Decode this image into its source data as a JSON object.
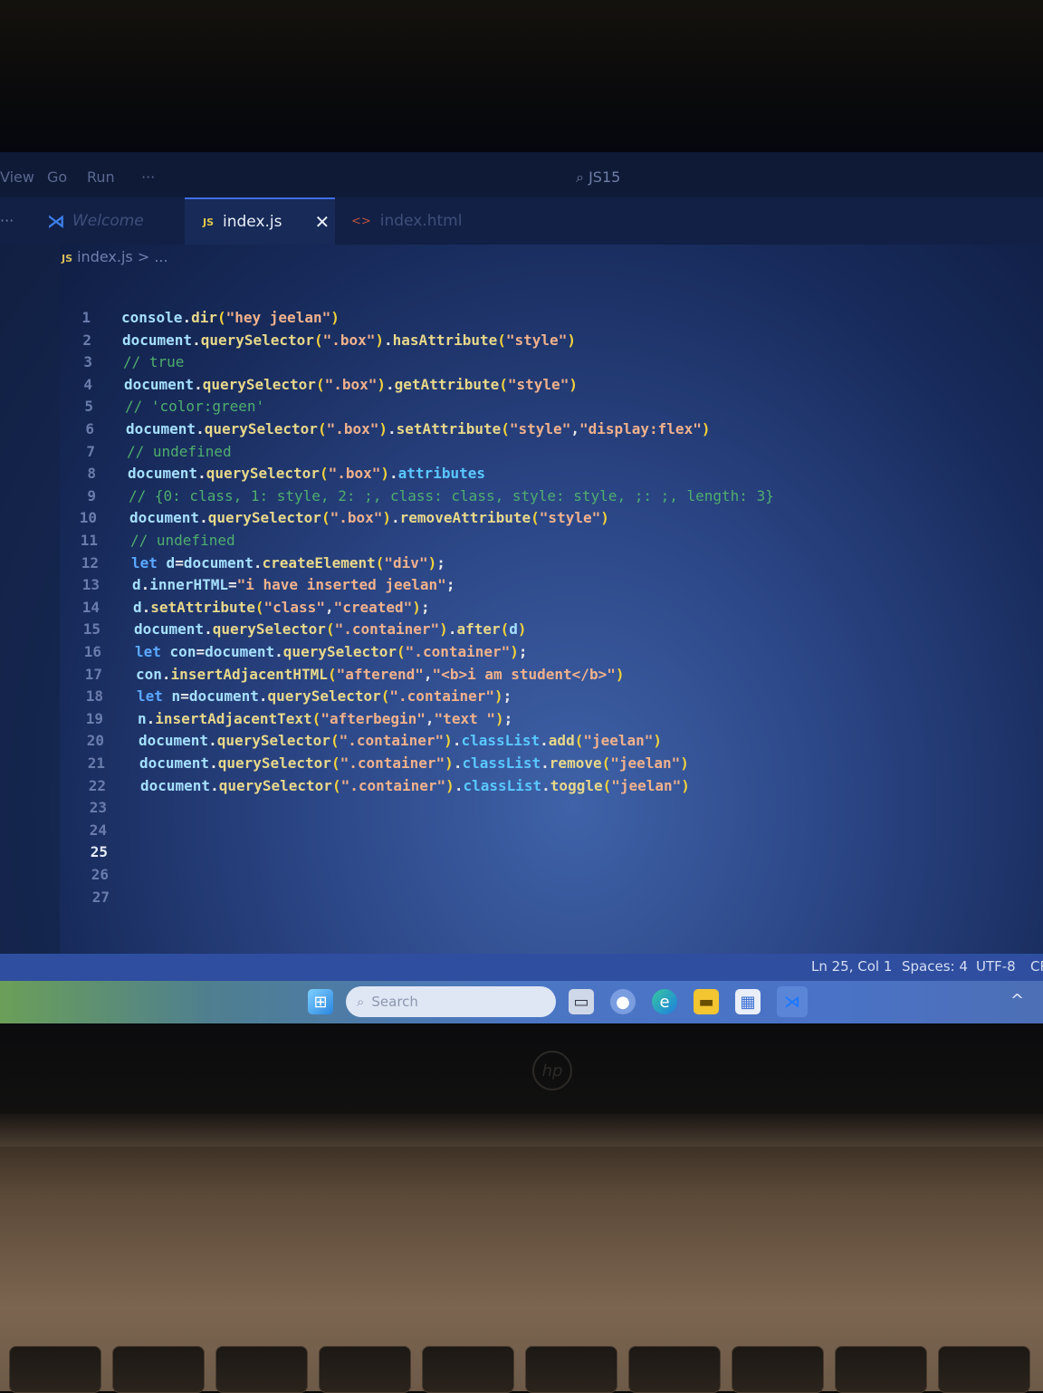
{
  "menubar": {
    "items": [
      "View",
      "Go",
      "Run",
      "···"
    ],
    "search": "JS15"
  },
  "tabs": [
    {
      "label": "Welcome",
      "icon": "vscode-logo-icon",
      "active": false
    },
    {
      "label": "index.js",
      "icon": "js-file-icon",
      "prefix": "JS",
      "active": true
    },
    {
      "label": "index.html",
      "icon": "html-file-icon",
      "active": false
    }
  ],
  "breadcrumb": {
    "prefix": "JS",
    "file": "index.js",
    "rest": "> ..."
  },
  "editor": {
    "lines": [
      {
        "n": "1",
        "text": "console.dir(\"hey jeelan\")"
      },
      {
        "n": "2",
        "text": "document.querySelector(\".box\").hasAttribute(\"style\")"
      },
      {
        "n": "3",
        "text": "// true"
      },
      {
        "n": "4",
        "text": "document.querySelector(\".box\").getAttribute(\"style\")"
      },
      {
        "n": "5",
        "text": "// 'color:green'"
      },
      {
        "n": "6",
        "text": "document.querySelector(\".box\").setAttribute(\"style\",\"display:flex\")"
      },
      {
        "n": "7",
        "text": "// undefined"
      },
      {
        "n": "8",
        "text": "document.querySelector(\".box\").attributes"
      },
      {
        "n": "9",
        "text": "// {0: class, 1: style, 2: ;, class: class, style: style, ;: ;, length: 3}"
      },
      {
        "n": "10",
        "text": "document.querySelector(\".box\").removeAttribute(\"style\")"
      },
      {
        "n": "11",
        "text": "// undefined"
      },
      {
        "n": "12",
        "text": "let d=document.createElement(\"div\");"
      },
      {
        "n": "13",
        "text": "d.innerHTML=\"i have inserted jeelan\";"
      },
      {
        "n": "14",
        "text": "d.setAttribute(\"class\",\"created\");"
      },
      {
        "n": "15",
        "text": "document.querySelector(\".container\").after(d)"
      },
      {
        "n": "16",
        "text": "let con=document.querySelector(\".container\");"
      },
      {
        "n": "17",
        "text": "con.insertAdjacentHTML(\"afterend\",\"<b>i am student</b>\")"
      },
      {
        "n": "18",
        "text": "let n=document.querySelector(\".container\");"
      },
      {
        "n": "19",
        "text": "n.insertAdjacentText(\"afterbegin\",\"text \");"
      },
      {
        "n": "20",
        "text": "document.querySelector(\".container\").classList.add(\"jeelan\")"
      },
      {
        "n": "21",
        "text": "document.querySelector(\".container\").classList.remove(\"jeelan\")"
      },
      {
        "n": "22",
        "text": "document.querySelector(\".container\").classList.toggle(\"jeelan\")"
      },
      {
        "n": "23",
        "text": ""
      },
      {
        "n": "24",
        "text": ""
      },
      {
        "n": "25",
        "text": ""
      },
      {
        "n": "26",
        "text": ""
      },
      {
        "n": "27",
        "text": ""
      }
    ],
    "cursor_line": 25
  },
  "status": {
    "position": "Ln 25, Col 1",
    "spaces": "Spaces: 4",
    "encoding": "UTF-8",
    "eol": "CR"
  },
  "taskbar": {
    "search_placeholder": "Search",
    "icons": [
      "windows-start-icon",
      "task-view-icon",
      "chat-icon",
      "edge-icon",
      "file-explorer-icon",
      "store-icon",
      "vscode-icon"
    ],
    "tray": "^"
  },
  "laptop_brand": "hp",
  "colors": {
    "keyword": "#5aa8ff",
    "string": "#f0b18c",
    "comment": "#4fae6e",
    "function": "#e8d88a",
    "paren": "#f2d23c",
    "statusbar": "#2f4ea0"
  }
}
